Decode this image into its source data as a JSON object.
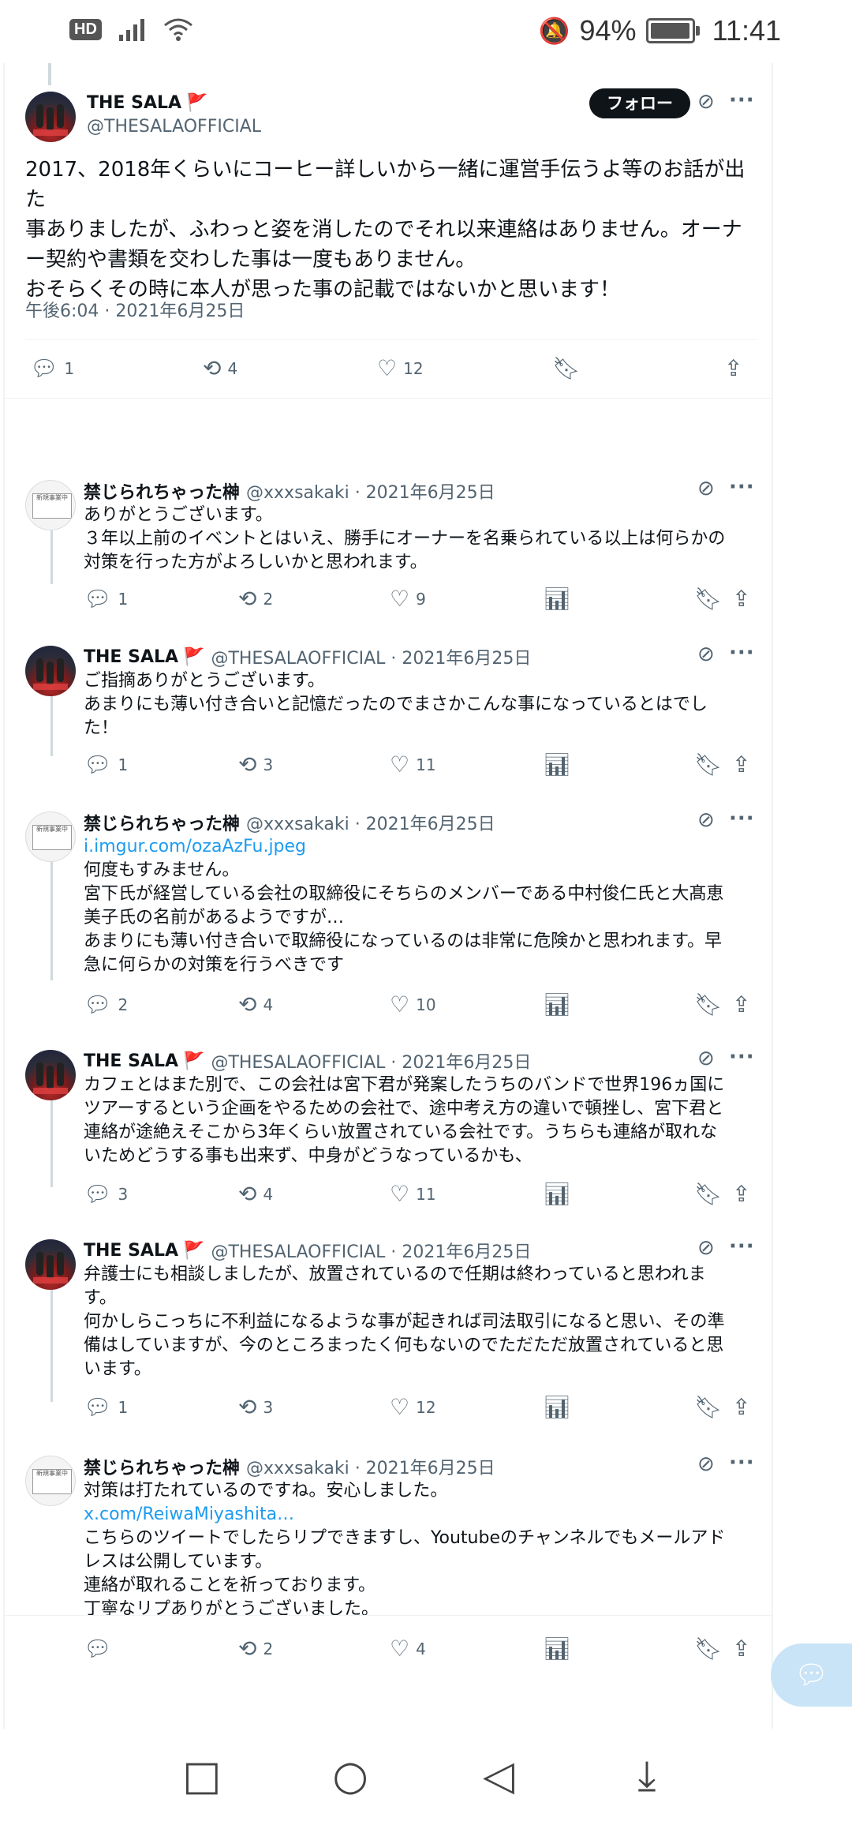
{
  "status_bar": {
    "left_badge": "HD",
    "battery": "94%",
    "time": "11:41"
  },
  "main_post": {
    "name": "THE SALA",
    "handle": "@THESALAOFFICIAL",
    "follow_label": "フォロー",
    "text": "2017、2018年くらいにコーヒー詳しいから一緒に運営手伝うよ等のお話が出た\n事ありましたが、ふわっと姿を消したのでそれ以来連絡はありません。オーナ\nー契約や書類を交わした事は一度もありません。\nおそらくその時に本人が思った事の記載ではないかと思います！",
    "timestamp": "午後6:04 · 2021年6月25日",
    "replies": "1",
    "reposts": "4",
    "likes": "12"
  },
  "replies": [
    {
      "name": "禁じられちゃった榊",
      "handle": "@xxxsakaki · 2021年6月25日",
      "text": "ありがとうございます。\n３年以上前のイベントとはいえ、勝手にオーナーを名乗られている以上は何らかの\n対策を行った方がよろしいかと思われます。",
      "link": "",
      "replies": "1",
      "reposts": "2",
      "likes": "9"
    },
    {
      "name": "THE SALA",
      "handle": "@THESALAOFFICIAL · 2021年6月25日",
      "text": "ご指摘ありがとうございます。\nあまりにも薄い付き合いと記憶だったのでまさかこんな事になっているとはでし\nた！",
      "link": "",
      "replies": "1",
      "reposts": "3",
      "likes": "11"
    },
    {
      "name": "禁じられちゃった榊",
      "handle": "@xxxsakaki · 2021年6月25日",
      "link": "i.imgur.com/ozaAzFu.jpeg",
      "text": "何度もすみません。\n宮下氏が経営している会社の取締役にそちらのメンバーである中村俊仁氏と大髙恵\n美子氏の名前があるようですが…\nあまりにも薄い付き合いで取締役になっているのは非常に危険かと思われます。早\n急に何らかの対策を行うべきです",
      "replies": "2",
      "reposts": "4",
      "likes": "10"
    },
    {
      "name": "THE SALA",
      "handle": "@THESALAOFFICIAL · 2021年6月25日",
      "text": "カフェとはまた別で、この会社は宮下君が発案したうちのバンドで世界196ヵ国に\nツアーするという企画をやるための会社で、途中考え方の違いで頓挫し、宮下君と\n連絡が途絶えそこから3年くらい放置されている会社です。うちらも連絡が取れな\nいためどうする事も出来ず、中身がどうなっているかも、",
      "link": "",
      "replies": "3",
      "reposts": "4",
      "likes": "11"
    },
    {
      "name": "THE SALA",
      "handle": "@THESALAOFFICIAL · 2021年6月25日",
      "text": "弁護士にも相談しましたが、放置されているので任期は終わっていると思われま\nす。\n何かしらこっちに不利益になるような事が起きれば司法取引になると思い、その準\n備はしていますが、今のところまったく何もないのでただただ放置されていると思\nいます。",
      "link": "",
      "replies": "1",
      "reposts": "3",
      "likes": "12"
    },
    {
      "name": "禁じられちゃった榊",
      "handle": "@xxxsakaki · 2021年6月25日",
      "text_before": "対策は打たれているのですね。安心しました。",
      "link": "x.com/ReiwaMiyashita…",
      "text": "こちらのツイートでしたらリプできますし、Youtubeのチャンネルでもメールアド\nレスは公開しています。\n連絡が取れることを祈っております。\n丁寧なリプありがとうございました。",
      "replies": "",
      "reposts": "2",
      "likes": "4"
    }
  ],
  "avatar_card_text": "新規事業中"
}
